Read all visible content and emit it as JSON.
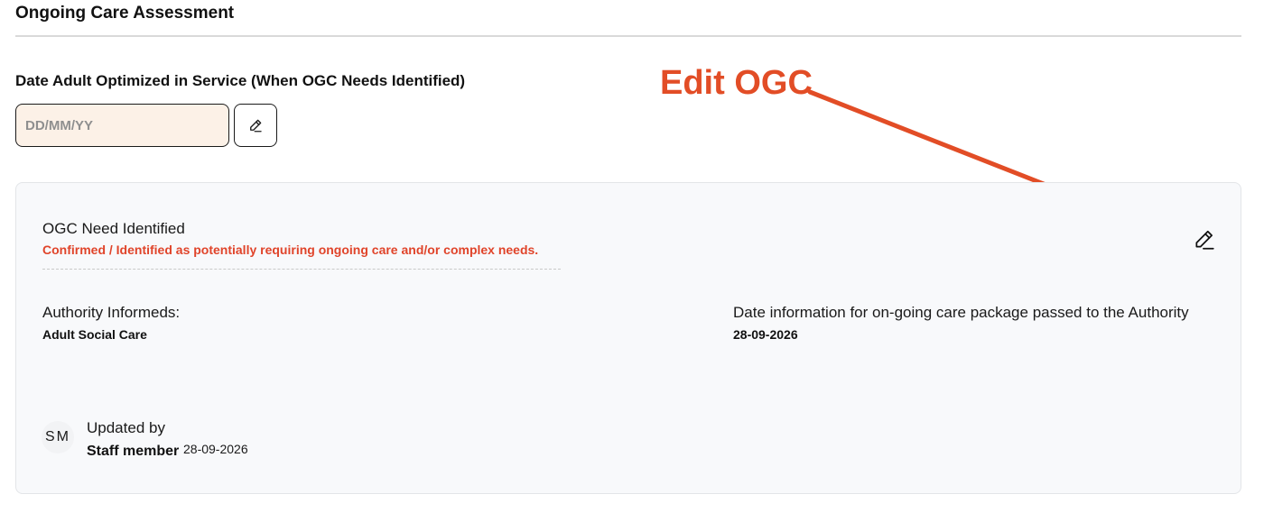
{
  "section": {
    "title": "Ongoing Care Assessment"
  },
  "optimized_date": {
    "label": "Date Adult Optimized in Service (When OGC Needs Identified)",
    "placeholder": "DD/MM/YY",
    "value": "",
    "edit_icon": "pencil-icon"
  },
  "annotation": {
    "label": "Edit OGC",
    "color": "#e24d26"
  },
  "card": {
    "ogc_title": "OGC Need Identified",
    "ogc_description": "Confirmed / Identified as potentially requiring ongoing care and/or complex needs.",
    "edit_icon": "pencil-icon",
    "authority": {
      "label": "Authority Informeds:",
      "value": "Adult Social Care"
    },
    "date_passed": {
      "label": "Date information for on-going care package passed to the Authority",
      "value": "28-09-2026"
    },
    "updated": {
      "avatar_initials": "SM",
      "label": "Updated by",
      "name": "Staff member",
      "date": "28-09-2026"
    }
  },
  "colors": {
    "accent_red": "#e0442a",
    "input_bg": "#fcf1e7",
    "card_bg": "#f8f9fb"
  }
}
